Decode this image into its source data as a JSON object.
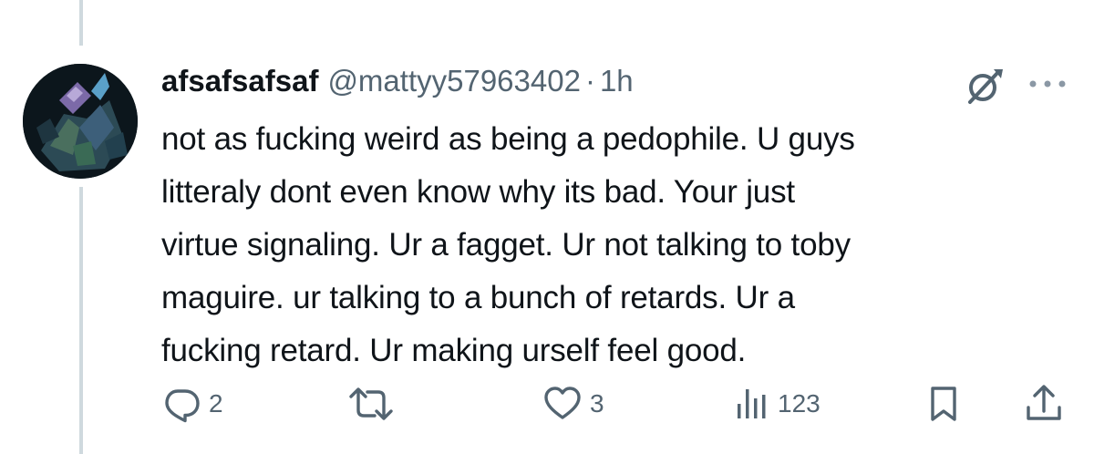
{
  "tweet": {
    "display_name": "afsafsafsaf",
    "handle": "@mattyy57963402",
    "separator": "·",
    "time": "1h",
    "text": "not as fucking weird as being a pedophile. U guys\nlitteraly dont even know why its bad. Your just\nvirtue signaling. Ur a fagget. Ur not talking to toby\nmaguire. ur talking to a bunch of retards. Ur a\nfucking retard. Ur making urself feel good."
  },
  "actions": {
    "reply_count": "2",
    "like_count": "3",
    "views_count": "123"
  },
  "icons": {
    "reply": "reply-icon",
    "retweet": "retweet-icon",
    "like": "like-icon",
    "views": "views-icon",
    "bookmark": "bookmark-icon",
    "share": "share-icon",
    "grok": "grok-icon",
    "more": "more-icon"
  },
  "colors": {
    "text_primary": "#0f1419",
    "text_secondary": "#536471",
    "thread_line": "#cfd9de",
    "icon": "#536471"
  }
}
